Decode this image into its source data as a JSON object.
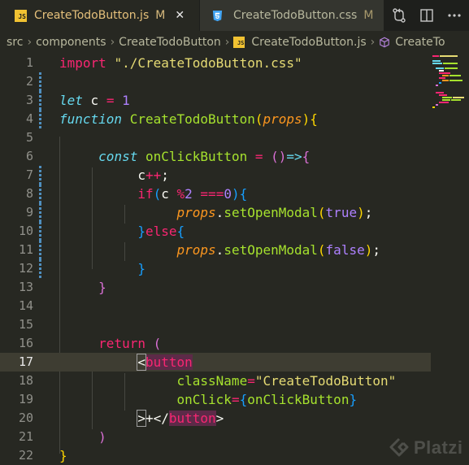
{
  "tabs": [
    {
      "name": "CreateTodoButton.js",
      "status": "M",
      "icon": "js-file-icon",
      "badge": "JS",
      "active": true,
      "close": "✕"
    },
    {
      "name": "CreateTodoButton.css",
      "status": "M",
      "icon": "css-file-icon",
      "active": false
    }
  ],
  "breadcrumb": {
    "items": [
      "src",
      "components",
      "CreateTodoButton",
      "CreateTodoButton.js",
      "CreateTo"
    ],
    "separator": "›",
    "badge": "JS"
  },
  "editor": {
    "current_line": 17,
    "line_numbers": [
      "1",
      "2",
      "3",
      "4",
      "5",
      "6",
      "7",
      "8",
      "9",
      "10",
      "11",
      "12",
      "13",
      "14",
      "15",
      "16",
      "17",
      "18",
      "19",
      "20",
      "21",
      "22"
    ]
  },
  "colors": {
    "background": "#272822",
    "keyword": "#f92672",
    "storage": "#66d9ef",
    "string": "#e6db74",
    "function": "#a6e22e",
    "parameter": "#fd971f",
    "number": "#ae81ff",
    "js_badge": "#f1c232",
    "css_badge": "#42a5f5"
  },
  "watermark": {
    "text": "Platzi",
    "icon": "platzi-logo-icon"
  }
}
